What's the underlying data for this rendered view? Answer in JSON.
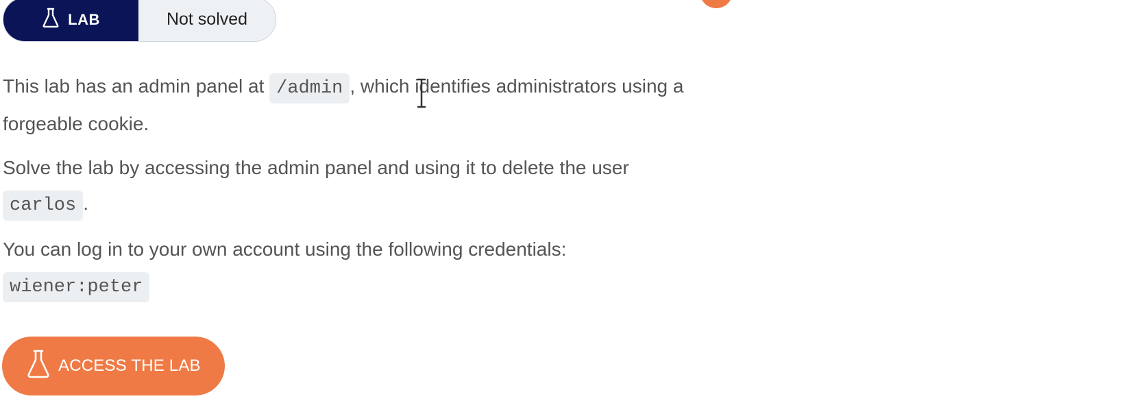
{
  "lab_status": {
    "badge_label": "LAB",
    "status": "Not solved"
  },
  "description": {
    "para1_before": "This lab has an admin panel at ",
    "para1_code": "/admin",
    "para1_after": ", which identifies administrators using a forgeable cookie.",
    "para2_before": "Solve the lab by accessing the admin panel and using it to delete the user ",
    "para2_code": "carlos",
    "para2_after": ".",
    "para3_text": "You can log in to your own account using the following credentials: ",
    "para3_code": "wiener:peter"
  },
  "access_button": {
    "label": "ACCESS THE LAB",
    "icon": "flask-icon"
  },
  "colors": {
    "lab_badge_bg": "#0a1457",
    "accent_orange": "#ef7a45",
    "progress_green": "#5ac54a"
  }
}
